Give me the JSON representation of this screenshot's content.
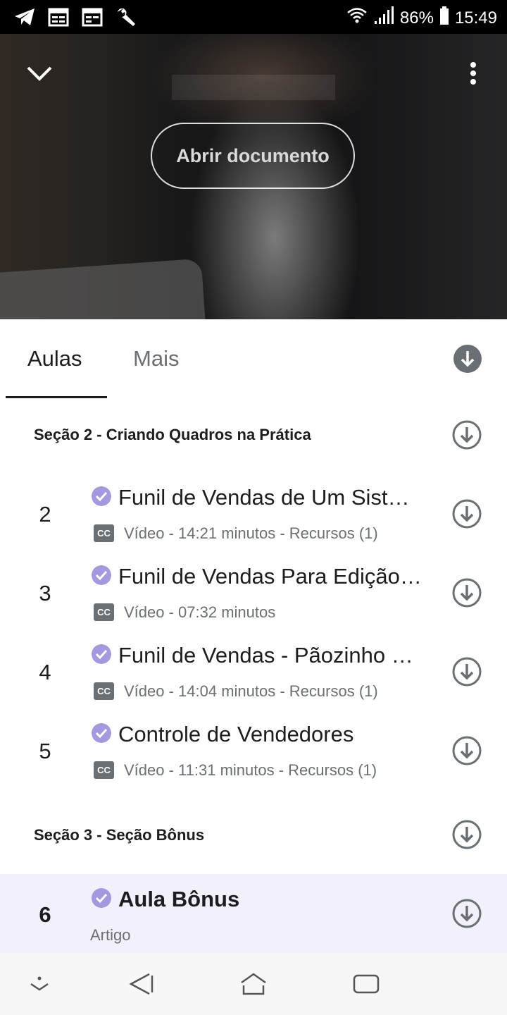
{
  "status_bar": {
    "battery": "86%",
    "time": "15:49",
    "left_icons": [
      "telegram-icon",
      "calendar-icon",
      "calendar-icon",
      "wrench-icon"
    ],
    "right_icons": [
      "wifi-icon",
      "signal-icon",
      "battery-icon"
    ]
  },
  "hero": {
    "open_document_label": "Abrir documento"
  },
  "tabs": [
    {
      "label": "Aulas",
      "active": true
    },
    {
      "label": "Mais",
      "active": false
    }
  ],
  "sections": [
    {
      "title": "Seção 2 - Criando Quadros na Prática",
      "lectures": [
        {
          "number": "2",
          "title": "Funil de Vendas de Um Sist…",
          "meta": "Vídeo - 14:21 minutos - Recursos (1)"
        },
        {
          "number": "3",
          "title": "Funil de Vendas Para Edição…",
          "meta": "Vídeo - 07:32 minutos"
        },
        {
          "number": "4",
          "title": "Funil de Vendas - Pãozinho …",
          "meta": "Vídeo - 14:04 minutos - Recursos (1)"
        },
        {
          "number": "5",
          "title": "Controle de Vendedores",
          "meta": "Vídeo - 11:31 minutos - Recursos (1)"
        }
      ]
    },
    {
      "title": "Seção 3 - Seção Bônus",
      "lectures": [
        {
          "number": "6",
          "title": "Aula Bônus",
          "meta": "Artigo"
        }
      ]
    }
  ],
  "cc_label": "CC",
  "colors": {
    "accent_purple": "#a499de",
    "highlight_row": "#f2f0fb",
    "icon_gray": "#6a6f73"
  }
}
